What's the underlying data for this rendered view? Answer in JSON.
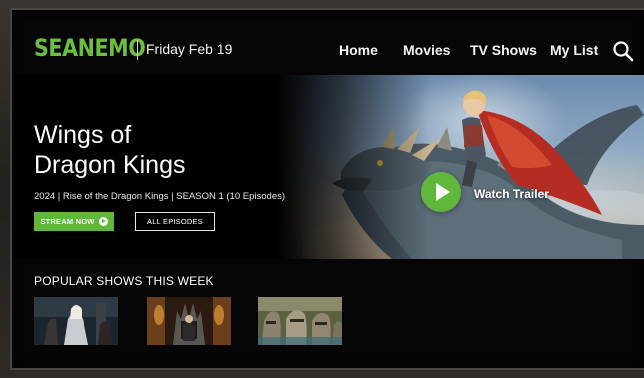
{
  "header": {
    "logo": "SEANEMO",
    "date": "Friday Feb 19",
    "nav": [
      "Home",
      "Movies",
      "TV Shows",
      "My List"
    ],
    "search_icon": "search-icon"
  },
  "hero": {
    "title_line1": "Wings of",
    "title_line2": "Dragon Kings",
    "meta": "2024 | Rise of the Dragon Kings | SEASON 1 (10 Episodes)",
    "stream_label": "STREAM NOW",
    "episodes_label": "ALL EPISODES",
    "trailer_label": "Watch Trailer",
    "accent": "#5fb83a"
  },
  "popular": {
    "title": "POPULAR SHOWS THIS WEEK",
    "thumbnails": [
      "show-thumbnail-1",
      "show-thumbnail-2",
      "show-thumbnail-3"
    ]
  }
}
